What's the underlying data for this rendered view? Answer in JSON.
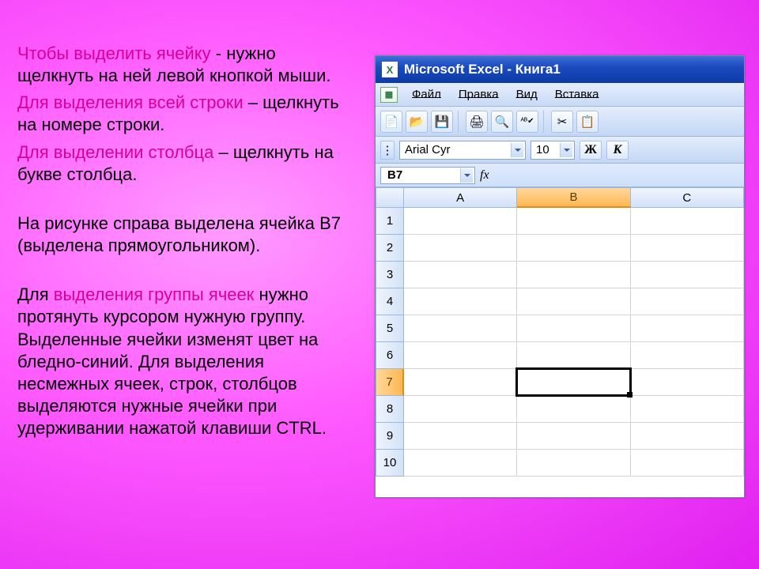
{
  "text": {
    "p1a": "Чтобы выделить ячейку",
    "p1b": "  -  нужно щелкнуть на ней левой кнопкой мыши.",
    "p2a": "Для выделения всей строки",
    "p2b": " – щелкнуть на номере строки.",
    "p3a": "Для выделении столбца",
    "p3b": " – щелкнуть на букве столбца.",
    "p4": "На рисунке справа выделена ячейка В7 (выделена прямоугольником).",
    "p5a": "Для ",
    "p5b": "выделения группы ячеек",
    "p5c": " нужно протянуть курсором нужную группу. Выделенные ячейки изменят цвет на бледно-синий. Для выделения несмежных ячеек, строк, столбцов выделяются нужные ячейки при удерживании нажатой клавиши CTRL."
  },
  "excel": {
    "title": "Microsoft Excel - Книга1",
    "menu": {
      "file": "Файл",
      "edit": "Правка",
      "view": "Вид",
      "insert": "Вставка"
    },
    "toolbar_icons": {
      "new": "📄",
      "open": "📂",
      "save": "💾",
      "print": "🖨",
      "preview": "🔍",
      "spell": "ᴬᴮ✔",
      "cut": "✂",
      "copy": "📋"
    },
    "font": {
      "name": "Arial Cyr",
      "size": "10",
      "bold": "Ж",
      "italic": "К"
    },
    "namebox": "B7",
    "fx": "fx",
    "columns": [
      "A",
      "B",
      "C"
    ],
    "rows": [
      "1",
      "2",
      "3",
      "4",
      "5",
      "6",
      "7",
      "8",
      "9",
      "10"
    ],
    "selected": {
      "row": 7,
      "col": "B"
    }
  }
}
